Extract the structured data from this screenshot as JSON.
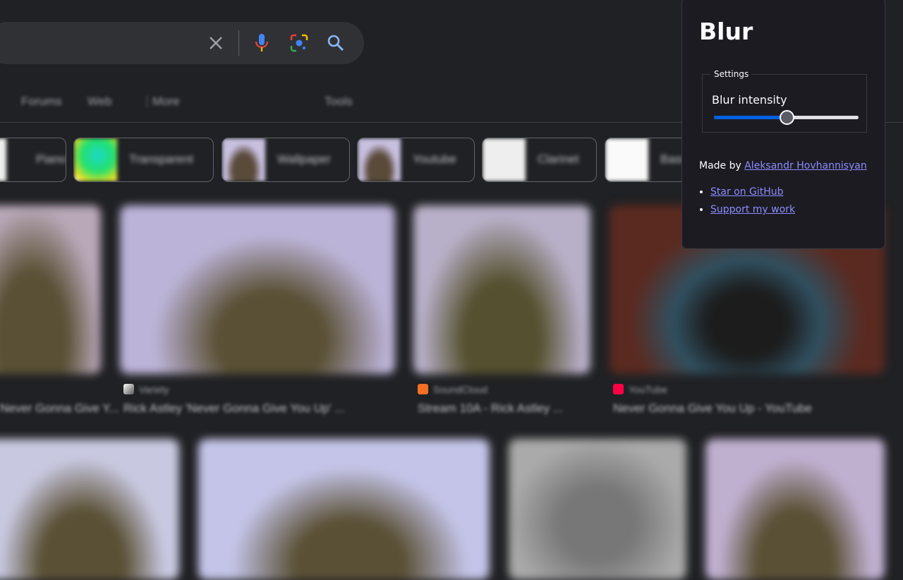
{
  "search": {
    "icons": [
      "close-icon",
      "mic-icon",
      "lens-icon",
      "search-icon"
    ]
  },
  "tabs": [
    "Forums",
    "Web",
    "More",
    "Tools"
  ],
  "chips": [
    {
      "label": "Piano"
    },
    {
      "label": "Transparent"
    },
    {
      "label": "Wallpaper"
    },
    {
      "label": "Youtube"
    },
    {
      "label": "Clarinet"
    },
    {
      "label": "Bass"
    }
  ],
  "results": [
    {
      "source": "",
      "caption": "Never Gonna Give Y..."
    },
    {
      "source": "Variety",
      "caption": "Rick Astley 'Never Gonna Give You Up' ..."
    },
    {
      "source": "SoundCloud",
      "caption": "Stream 10A - Rick Astley ..."
    },
    {
      "source": "YouTube",
      "caption": "Never Gonna Give You Up - YouTube"
    }
  ],
  "popup": {
    "title": "Blur",
    "settings_legend": "Settings",
    "blur_label": "Blur intensity",
    "blur_value_percent": 50,
    "made_by": "Made by ",
    "author": "Aleksandr Hovhannisyan",
    "links": [
      "Star on GitHub",
      "Support my work"
    ],
    "accent": "#0061e0",
    "link_color": "#8c8cff"
  }
}
